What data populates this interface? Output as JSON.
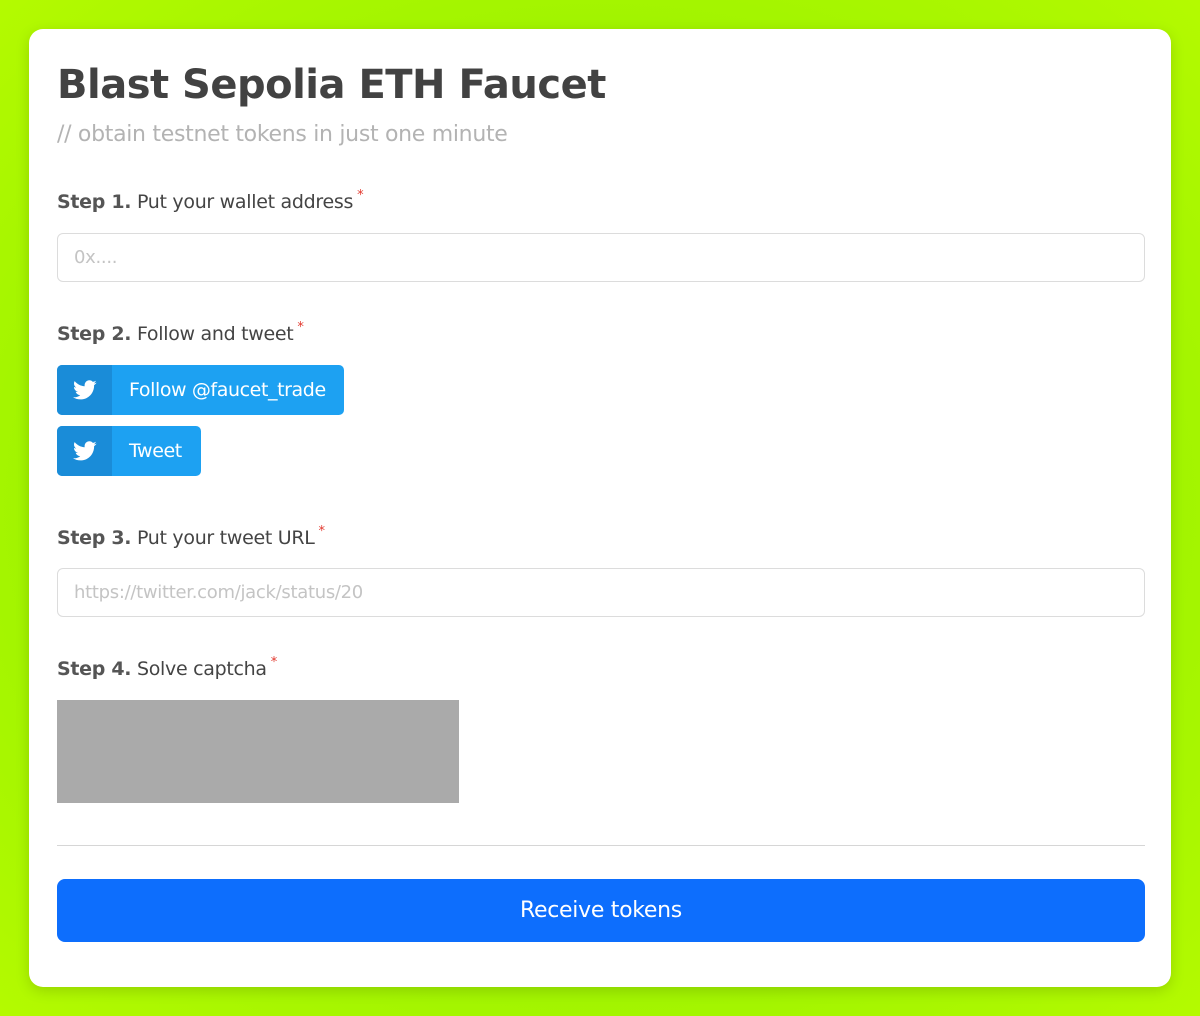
{
  "header": {
    "title": "Blast Sepolia ETH Faucet",
    "subtitle": "// obtain testnet tokens in just one minute"
  },
  "steps": [
    {
      "number": "Step 1.",
      "text": "Put your wallet address",
      "required_mark": "*"
    },
    {
      "number": "Step 2.",
      "text": "Follow and tweet",
      "required_mark": "*"
    },
    {
      "number": "Step 3.",
      "text": "Put your tweet URL",
      "required_mark": "*"
    },
    {
      "number": "Step 4.",
      "text": "Solve captcha",
      "required_mark": "*"
    }
  ],
  "wallet_input": {
    "placeholder": "0x....",
    "value": ""
  },
  "tweet_url_input": {
    "placeholder": "https://twitter.com/jack/status/20",
    "value": ""
  },
  "buttons": {
    "follow_label": "Follow @faucet_trade",
    "tweet_label": "Tweet",
    "submit_label": "Receive tokens"
  },
  "icons": {
    "follow": "twitter-bird-icon",
    "tweet": "twitter-bird-icon"
  },
  "colors": {
    "background": "#95f100",
    "primary_button": "#0d6efd",
    "twitter_button": "#1da1f2",
    "twitter_icon_box": "#1a8cd8",
    "required_mark": "#e2372c",
    "captcha_placeholder": "#aaaaaa"
  }
}
